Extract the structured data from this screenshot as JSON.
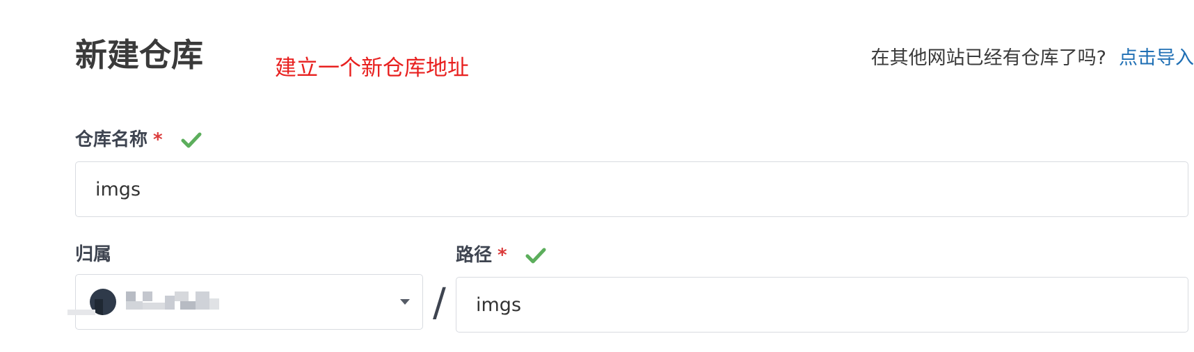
{
  "page": {
    "title": "新建仓库",
    "annotation": "建立一个新仓库地址"
  },
  "import": {
    "question": "在其他网站已经有仓库了吗?",
    "link_label": "点击导入"
  },
  "form": {
    "repo_name": {
      "label": "仓库名称",
      "required_mark": "*",
      "value": "imgs",
      "valid": true
    },
    "owner": {
      "label": "归属",
      "value_obscured": true
    },
    "separator": "/",
    "path": {
      "label": "路径",
      "required_mark": "*",
      "value": "imgs",
      "valid": true
    }
  },
  "colors": {
    "annotation": "#e8201f",
    "link": "#1f6fb4",
    "required": "#db3b3b",
    "valid_check": "#5cae5c",
    "border": "#d8dbe0"
  }
}
